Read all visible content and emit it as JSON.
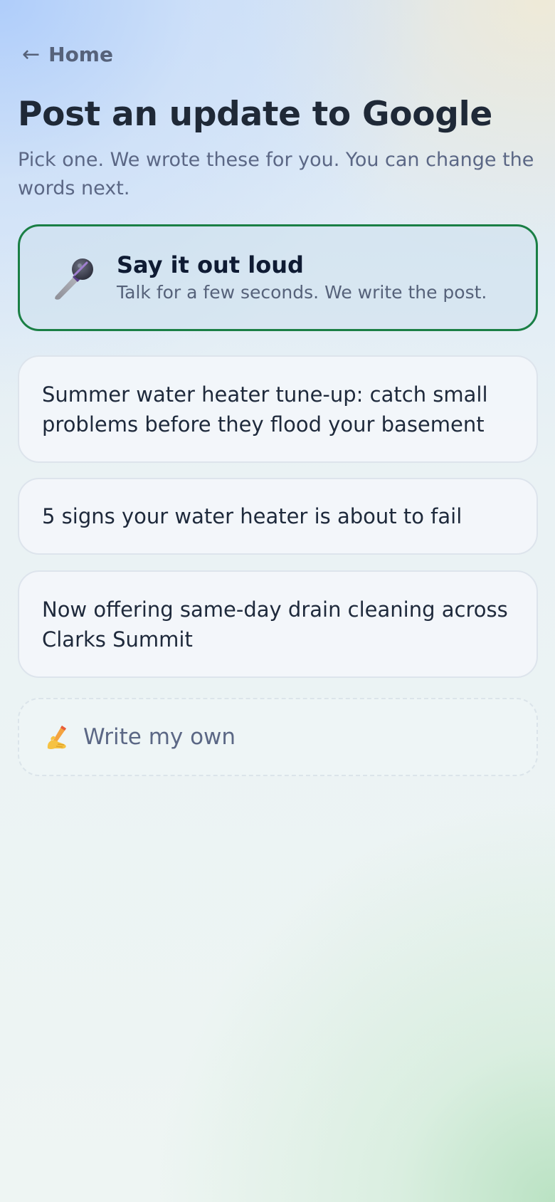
{
  "nav": {
    "back_arrow": "←",
    "back_label": "Home"
  },
  "header": {
    "title": "Post an update to Google",
    "subtitle": "Pick one. We wrote these for you. You can change the words next."
  },
  "voice_option": {
    "icon": "microphone-icon",
    "title": "Say it out loud",
    "subtitle": "Talk for a few seconds. We write the post."
  },
  "suggestions": [
    {
      "text": "Summer water heater tune-up: catch small problems before they flood your basement"
    },
    {
      "text": "5 signs your water heater is about to fail"
    },
    {
      "text": "Now offering same-day drain cleaning across Clarks Summit"
    }
  ],
  "write_own": {
    "icon": "writing-hand-icon",
    "label": "Write my own"
  },
  "colors": {
    "accent_border": "#1a7f45",
    "title_text": "#1f2937",
    "muted_text": "#5b6785"
  }
}
